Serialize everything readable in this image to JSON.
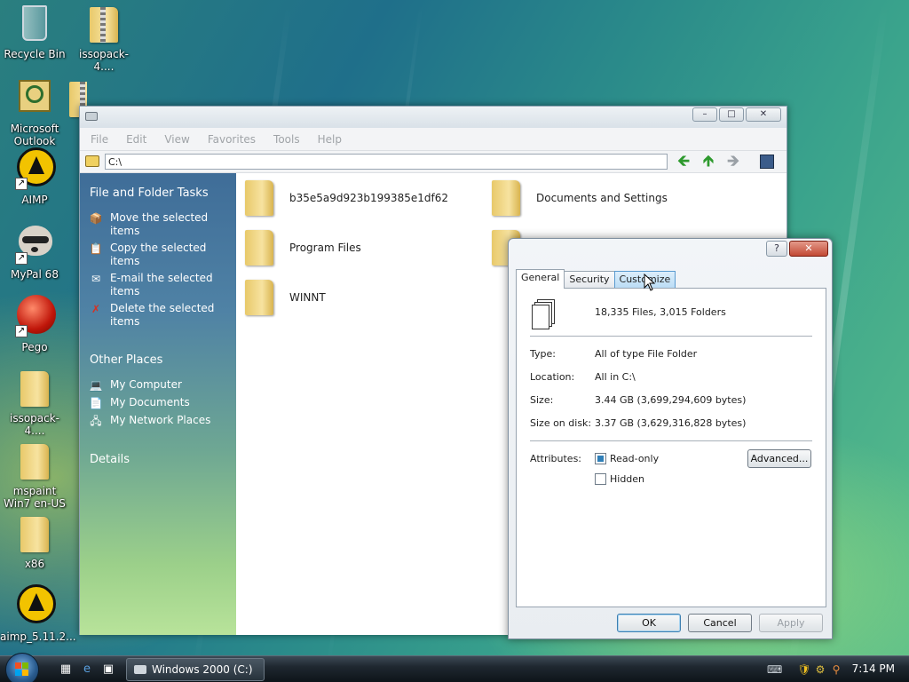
{
  "desktop": {
    "icons": [
      {
        "label": "Recycle Bin"
      },
      {
        "label": "issopack-4...."
      },
      {
        "label": "Microsoft Outlook"
      },
      {
        "label": "AIMP"
      },
      {
        "label": "MyPal 68"
      },
      {
        "label": "Pego"
      },
      {
        "label": "issopack-4...."
      },
      {
        "label": "mspaint Win7 en-US"
      },
      {
        "label": "x86"
      },
      {
        "label": "aimp_5.11.2..."
      }
    ]
  },
  "explorer": {
    "menu": [
      "File",
      "Edit",
      "View",
      "Favorites",
      "Tools",
      "Help"
    ],
    "address": "C:\\",
    "window_buttons": {
      "minimize": "–",
      "maximize": "□",
      "close": "✕"
    },
    "sidebar": {
      "tasks_title": "File and Folder Tasks",
      "tasks": [
        {
          "label": "Move the selected items",
          "icon": "move-icon"
        },
        {
          "label": "Copy the selected items",
          "icon": "copy-icon"
        },
        {
          "label": "E-mail the selected items",
          "icon": "email-icon"
        },
        {
          "label": "Delete the selected items",
          "icon": "delete-icon"
        }
      ],
      "other_title": "Other Places",
      "other": [
        {
          "label": "My Computer",
          "icon": "computer-icon"
        },
        {
          "label": "My Documents",
          "icon": "documents-icon"
        },
        {
          "label": "My Network Places",
          "icon": "network-icon"
        }
      ],
      "details_title": "Details"
    },
    "items": [
      {
        "label": "b35e5a9d923b199385e1df62"
      },
      {
        "label": "Documents and Settings"
      },
      {
        "label": "Program Files"
      },
      {
        "label": ""
      },
      {
        "label": "WINNT"
      }
    ]
  },
  "properties": {
    "help_label": "?",
    "close_label": "✕",
    "tabs": [
      "General",
      "Security",
      "Customize"
    ],
    "summary": "18,335 Files, 3,015 Folders",
    "rows": [
      {
        "label": "Type:",
        "value": "All of type File Folder"
      },
      {
        "label": "Location:",
        "value": "All in C:\\"
      },
      {
        "label": "Size:",
        "value": "3.44 GB (3,699,294,609 bytes)"
      },
      {
        "label": "Size on disk:",
        "value": "3.37 GB (3,629,316,828 bytes)"
      }
    ],
    "attributes_label": "Attributes:",
    "readonly_label": "Read-only",
    "hidden_label": "Hidden",
    "advanced_label": "Advanced...",
    "ok_label": "OK",
    "cancel_label": "Cancel",
    "apply_label": "Apply"
  },
  "taskbar": {
    "task_label": "Windows 2000 (C:)",
    "clock": "7:14 PM"
  },
  "colors": {
    "sidebar_top": "#3f6d98",
    "sidebar_bottom": "#b8e39a",
    "taskbar": "#1f2830",
    "accent": "#2f7fb8"
  }
}
